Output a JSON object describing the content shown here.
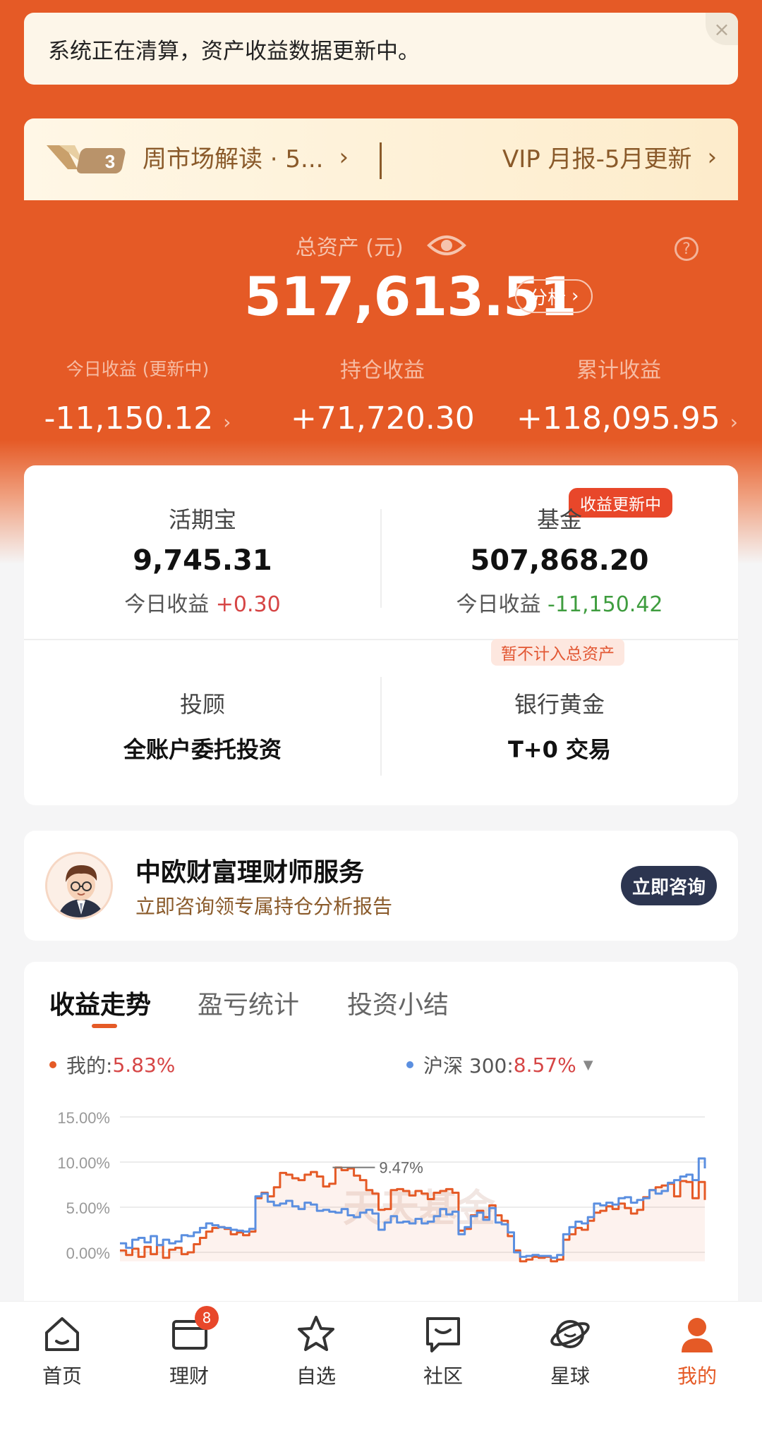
{
  "notice": {
    "text": "系统正在清算，资产收益数据更新中。",
    "close": "×"
  },
  "vip_bar": {
    "badge": "3",
    "left_text": "周市场解读 · 5...",
    "right_text": "VIP 月报-5月更新"
  },
  "assets": {
    "total_label": "总资产 (元)",
    "total_value": "517,613.51",
    "analyze_label": "分析",
    "help": "?",
    "today": {
      "label": "今日收益 (更新中)",
      "value": "-11,150.12"
    },
    "holding": {
      "label": "持仓收益",
      "value": "+71,720.30"
    },
    "cumulative": {
      "label": "累计收益",
      "value": "+118,095.95"
    }
  },
  "products": {
    "huoqibao": {
      "title": "活期宝",
      "amount": "9,745.31",
      "today_label": "今日收益",
      "today_value": "+0.30"
    },
    "fund": {
      "title": "基金",
      "amount": "507,868.20",
      "today_label": "今日收益",
      "today_value": "-11,150.42",
      "badge": "收益更新中"
    },
    "advisor": {
      "title": "投顾",
      "desc": "全账户委托投资"
    },
    "bank_gold": {
      "title": "银行黄金",
      "desc": "T+0 交易",
      "badge": "暂不计入总资产"
    }
  },
  "advisor_card": {
    "title": "中欧财富理财师服务",
    "subtitle": "立即咨询领专属持仓分析报告",
    "button": "立即咨询"
  },
  "chart_section": {
    "tabs": [
      "收益走势",
      "盈亏统计",
      "投资小结"
    ],
    "legend_mine_label": "我的:",
    "legend_mine_value": "5.83%",
    "legend_index_label": "沪深 300:",
    "legend_index_value": "8.57%",
    "mine_color": "#e55a26",
    "index_color": "#5b8fe0",
    "watermark": "天天基金"
  },
  "chart_data": {
    "type": "line",
    "y_ticks": [
      "15.00%",
      "10.00%",
      "5.00%",
      "0.00%"
    ],
    "ylim": [
      -1,
      15
    ],
    "annotation": "9.47%",
    "series": [
      {
        "name": "我的",
        "values": [
          0.2,
          -0.3,
          0.4,
          -0.5,
          0.6,
          -0.2,
          0.8,
          -0.6,
          0.3,
          0.5,
          -0.2,
          0.0,
          0.9,
          1.6,
          2.3,
          2.7,
          2.8,
          2.6,
          2.0,
          2.2,
          1.9,
          2.3,
          6.0,
          6.6,
          6.2,
          7.2,
          8.8,
          8.6,
          8.2,
          8.0,
          8.6,
          8.9,
          8.4,
          7.3,
          7.6,
          9.4,
          9.1,
          9.3,
          8.5,
          8.0,
          6.9,
          6.5,
          4.7,
          4.8,
          6.9,
          7.0,
          6.8,
          6.3,
          6.8,
          6.5,
          5.9,
          6.6,
          6.8,
          7.0,
          6.6,
          2.4,
          2.6,
          4.1,
          4.6,
          3.9,
          5.2,
          4.1,
          3.5,
          1.8,
          0.2,
          -1.0,
          -0.8,
          -0.5,
          -0.6,
          -0.5,
          -1.0,
          -0.8,
          1.4,
          2.0,
          2.7,
          2.5,
          3.5,
          4.4,
          4.6,
          5.1,
          4.8,
          5.4,
          4.9,
          4.3,
          4.7,
          6.1,
          6.9,
          7.2,
          7.4,
          7.6,
          6.2,
          7.9,
          7.8,
          6.0,
          7.8,
          5.8
        ]
      },
      {
        "name": "沪深 300",
        "values": [
          1.0,
          0.5,
          1.4,
          1.6,
          1.1,
          1.8,
          0.8,
          1.4,
          1.0,
          1.2,
          1.9,
          1.8,
          2.2,
          2.7,
          3.2,
          3.0,
          2.8,
          2.7,
          2.5,
          2.4,
          2.3,
          2.6,
          6.2,
          6.5,
          5.6,
          5.2,
          5.4,
          5.7,
          5.1,
          4.8,
          5.5,
          5.3,
          4.6,
          4.7,
          4.5,
          4.4,
          4.8,
          4.1,
          3.9,
          4.4,
          4.7,
          4.3,
          2.5,
          3.3,
          4.0,
          3.3,
          3.4,
          3.2,
          3.7,
          3.2,
          3.4,
          4.0,
          4.8,
          4.2,
          4.5,
          2.0,
          2.8,
          4.0,
          4.4,
          3.6,
          4.9,
          3.3,
          3.1,
          2.2,
          0.0,
          -0.5,
          -0.4,
          -0.3,
          -0.4,
          -0.4,
          -0.6,
          -0.3,
          2.0,
          2.8,
          3.4,
          3.2,
          3.9,
          5.4,
          5.2,
          5.5,
          5.3,
          6.0,
          6.1,
          5.5,
          5.8,
          6.0,
          6.9,
          6.5,
          6.8,
          7.7,
          8.0,
          8.4,
          8.6,
          8.0,
          10.4,
          9.3
        ]
      }
    ]
  },
  "tabbar": {
    "items": [
      {
        "label": "首页",
        "icon": "home-icon"
      },
      {
        "label": "理财",
        "icon": "wallet-icon",
        "badge": "8"
      },
      {
        "label": "自选",
        "icon": "star-icon"
      },
      {
        "label": "社区",
        "icon": "chat-icon"
      },
      {
        "label": "星球",
        "icon": "planet-icon"
      },
      {
        "label": "我的",
        "icon": "profile-icon"
      }
    ]
  }
}
